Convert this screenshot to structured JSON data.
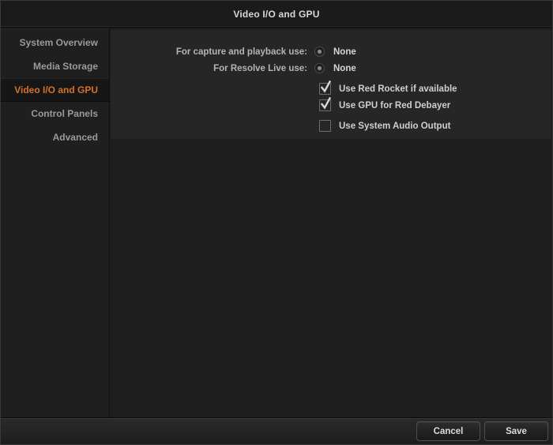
{
  "window": {
    "title": "Video I/O and GPU"
  },
  "sidebar": {
    "items": [
      {
        "label": "System Overview",
        "selected": false
      },
      {
        "label": "Media Storage",
        "selected": false
      },
      {
        "label": "Video I/O and GPU",
        "selected": true
      },
      {
        "label": "Control Panels",
        "selected": false
      },
      {
        "label": "Advanced",
        "selected": false
      }
    ]
  },
  "main": {
    "rows": [
      {
        "label": "For capture and playback use:",
        "value": "None",
        "selected": true
      },
      {
        "label": "For Resolve Live use:",
        "value": "None",
        "selected": true
      }
    ],
    "checkboxes": [
      {
        "label": "Use Red Rocket if available",
        "checked": true
      },
      {
        "label": "Use GPU for Red Debayer",
        "checked": true
      },
      {
        "label": "Use System Audio Output",
        "checked": false
      }
    ]
  },
  "footer": {
    "cancel_label": "Cancel",
    "save_label": "Save"
  },
  "colors": {
    "accent": "#d4722a",
    "window_bg": "#1e1e1e",
    "panel_bg": "#262626",
    "sidebar_bg": "#1f1f1f",
    "text": "#cfcfcf"
  }
}
